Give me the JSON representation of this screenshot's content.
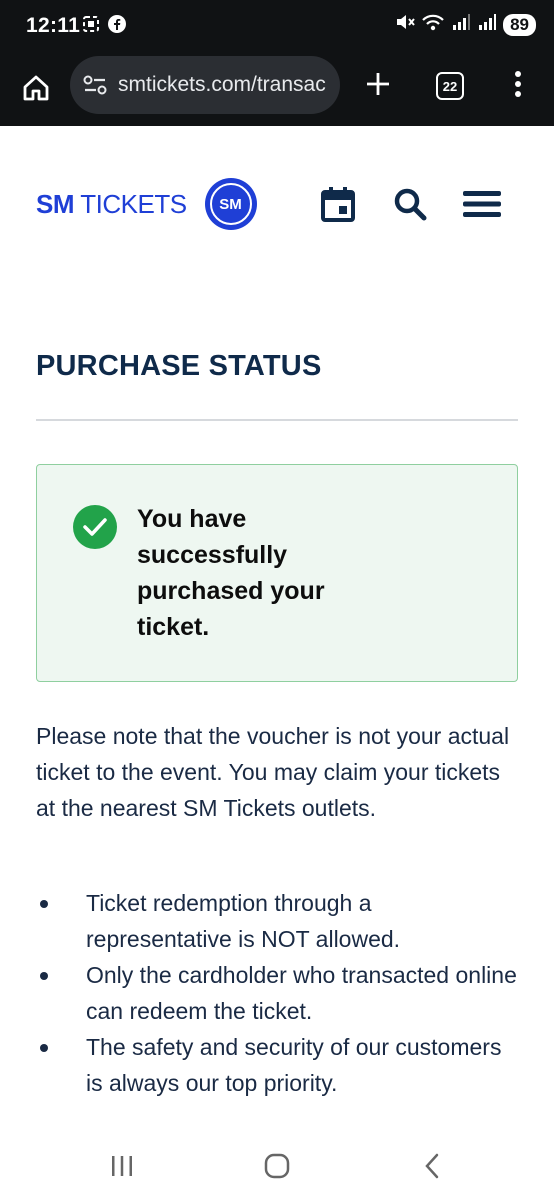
{
  "status_bar": {
    "time": "12:11",
    "battery": "89",
    "icons": [
      "screenshot-icon",
      "facebook-icon",
      "mute-icon",
      "wifi-icon",
      "signal-icon",
      "signal-icon"
    ]
  },
  "browser": {
    "url": "smtickets.com/transac",
    "tab_count": "22",
    "icons": [
      "home-icon",
      "site-settings-icon",
      "plus-icon",
      "tabs-icon",
      "more-icon"
    ]
  },
  "site": {
    "logo_bold": "SM",
    "logo_light": " TICKETS",
    "badge": "SM",
    "header_icons": [
      "calendar-icon",
      "search-icon",
      "menu-icon"
    ],
    "brand_color": "#1f3fd6"
  },
  "content": {
    "title": "PURCHASE STATUS",
    "success_message": "You have successfully purchased your ticket.",
    "note": "Please note that the voucher is not your actual ticket to the event. You may claim your tickets at the nearest SM Tickets outlets.",
    "bullets": [
      "Ticket redemption through a representative is NOT allowed.",
      "Only the cardholder who transacted online can redeem the ticket.",
      "The safety and security of our customers is always our top priority."
    ],
    "success_color": "#22a34a"
  },
  "nav_bar": {
    "icons": [
      "recent-apps-icon",
      "home-button-icon",
      "back-icon"
    ]
  }
}
